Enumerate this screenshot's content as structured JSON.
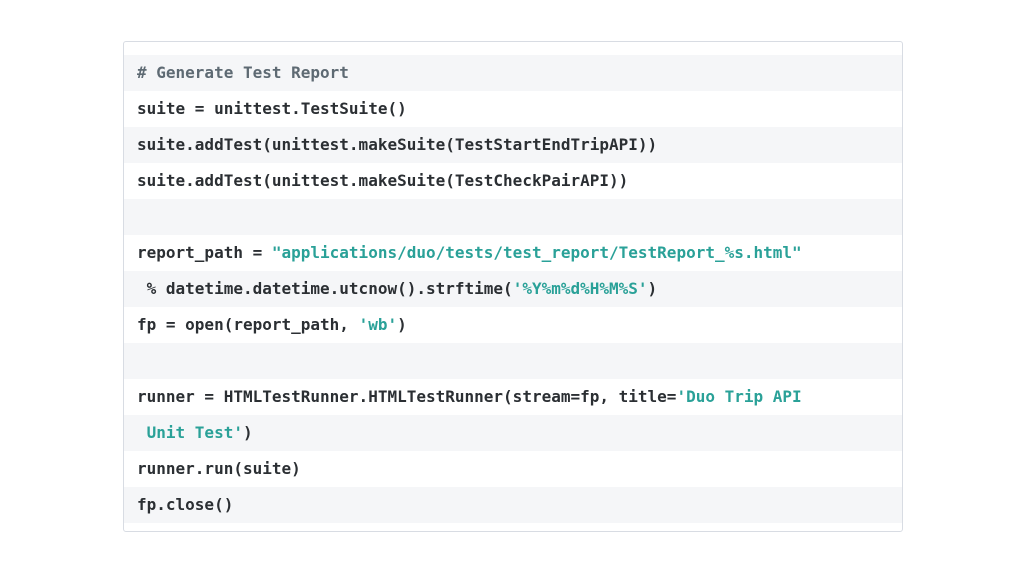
{
  "code_block": {
    "lines": [
      [
        {
          "text": "# Generate Test Report",
          "type": "comment"
        }
      ],
      [
        {
          "text": "suite = unittest.TestSuite()",
          "type": "plain"
        }
      ],
      [
        {
          "text": "suite.addTest(unittest.makeSuite(TestStartEndTripAPI))",
          "type": "plain"
        }
      ],
      [
        {
          "text": "suite.addTest(unittest.makeSuite(TestCheckPairAPI))",
          "type": "plain"
        }
      ],
      [],
      [
        {
          "text": "report_path = ",
          "type": "plain"
        },
        {
          "text": "\"applications/duo/tests/test_report/TestReport_%s.html\"",
          "type": "string"
        }
      ],
      [
        {
          "text": " % datetime.datetime.utcnow().strftime(",
          "type": "plain"
        },
        {
          "text": "'%Y%m%d%H%M%S'",
          "type": "string"
        },
        {
          "text": ")",
          "type": "plain"
        }
      ],
      [
        {
          "text": "fp = open(report_path, ",
          "type": "plain"
        },
        {
          "text": "'wb'",
          "type": "string"
        },
        {
          "text": ")",
          "type": "plain"
        }
      ],
      [],
      [
        {
          "text": "runner = HTMLTestRunner.HTMLTestRunner(stream=fp, title=",
          "type": "plain"
        },
        {
          "text": "'Duo Trip API",
          "type": "string"
        }
      ],
      [
        {
          "text": " Unit Test'",
          "type": "string"
        },
        {
          "text": ")",
          "type": "plain"
        }
      ],
      [
        {
          "text": "runner.run(suite)",
          "type": "plain"
        }
      ],
      [
        {
          "text": "fp.close()",
          "type": "plain"
        }
      ]
    ]
  }
}
